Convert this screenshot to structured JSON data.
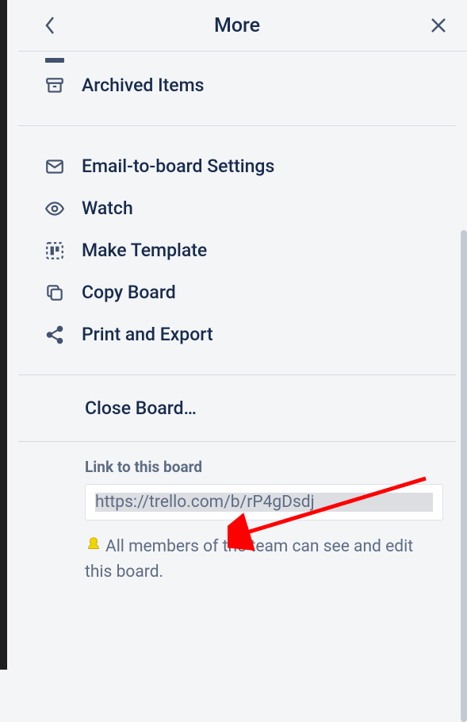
{
  "header": {
    "title": "More"
  },
  "menu": {
    "archived": "Archived Items",
    "email": "Email-to-board Settings",
    "watch": "Watch",
    "template": "Make Template",
    "copy": "Copy Board",
    "print": "Print and Export",
    "close": "Close Board…"
  },
  "link": {
    "label": "Link to this board",
    "url": "https://trello.com/b/rP4gDsdj",
    "visibility": "All members of the team can see and edit this board."
  }
}
